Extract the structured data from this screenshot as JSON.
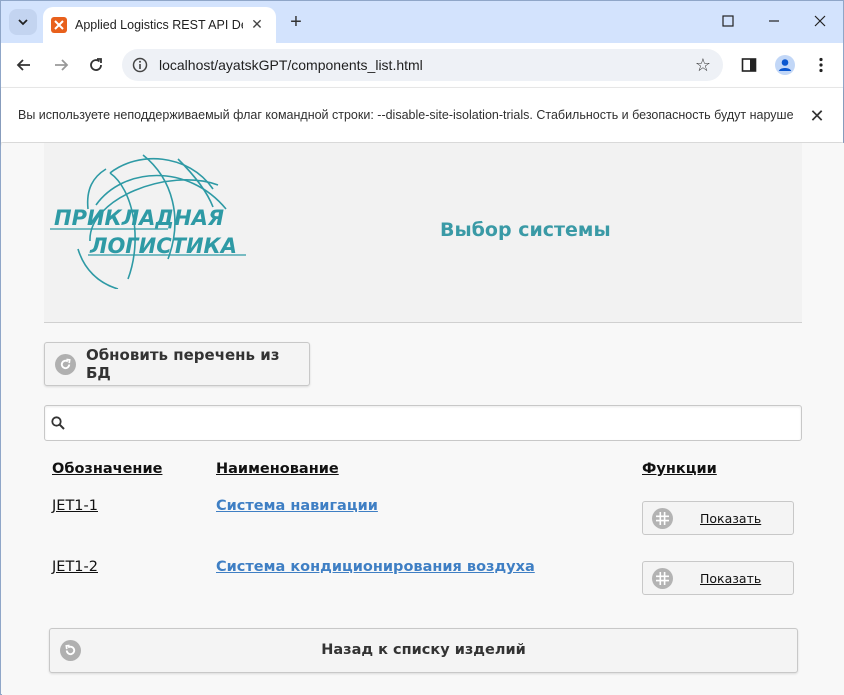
{
  "browser": {
    "tab_title": "Applied Logistics REST API Demo",
    "url": "localhost/ayatskGPT/components_list.html",
    "infobar_text": "Вы используете неподдерживаемый флаг командной строки: --disable-site-isolation-trials. Стабильность и безопасность будут нарушены."
  },
  "header": {
    "logo_line1": "ПРИКЛАДНАЯ",
    "logo_line2": "ЛОГИСТИКА",
    "title": "Выбор системы"
  },
  "toolbar": {
    "refresh_label": "Обновить перечень из БД"
  },
  "search": {
    "value": "",
    "placeholder": ""
  },
  "table": {
    "columns": [
      "Обозначение",
      "Наименование",
      "Функции"
    ],
    "rows": [
      {
        "code": "JET1-1",
        "name": "Система навигации",
        "action": "Показать"
      },
      {
        "code": "JET1-2",
        "name": "Система кондиционирования воздуха",
        "action": "Показать"
      }
    ]
  },
  "footer": {
    "back_label": "Назад к списку изделий"
  },
  "colors": {
    "brand_teal": "#3a9aa6",
    "link_blue": "#3f7fc4",
    "chrome_tab_strip": "#d3e3fd"
  }
}
